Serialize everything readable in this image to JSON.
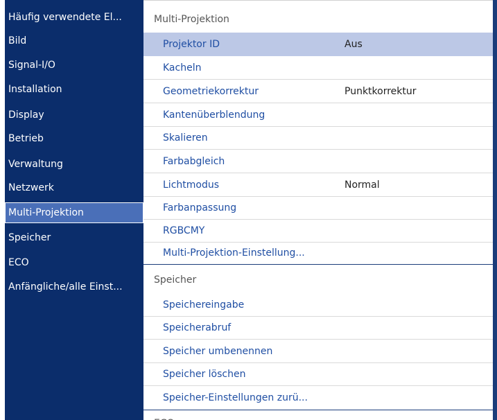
{
  "sidebar": {
    "items": [
      {
        "label": "Häufig verwendete El..."
      },
      {
        "label": "Bild"
      },
      {
        "label": "Signal-I/O"
      },
      {
        "label": "Installation"
      },
      {
        "label": "Display"
      },
      {
        "label": "Betrieb"
      },
      {
        "label": "Verwaltung"
      },
      {
        "label": "Netzwerk"
      },
      {
        "label": "Multi-Projektion"
      },
      {
        "label": "Speicher"
      },
      {
        "label": "ECO"
      },
      {
        "label": "Anfängliche/alle Einst..."
      }
    ],
    "selected_index": 8
  },
  "main": {
    "sections": [
      {
        "title": "Multi-Projektion",
        "rows": [
          {
            "label": "Projektor ID",
            "value": "Aus"
          },
          {
            "label": "Kacheln",
            "value": ""
          },
          {
            "label": "Geometriekorrektur",
            "value": "Punktkorrektur"
          },
          {
            "label": "Kantenüberblendung",
            "value": ""
          },
          {
            "label": "Skalieren",
            "value": ""
          },
          {
            "label": "Farbabgleich",
            "value": ""
          },
          {
            "label": "Lichtmodus",
            "value": "Normal"
          },
          {
            "label": "Farbanpassung",
            "value": ""
          },
          {
            "label": "RGBCMY",
            "value": ""
          },
          {
            "label": "Multi-Projektion-Einstellung...",
            "value": ""
          }
        ]
      },
      {
        "title": "Speicher",
        "rows": [
          {
            "label": "Speichereingabe",
            "value": ""
          },
          {
            "label": "Speicherabruf",
            "value": ""
          },
          {
            "label": "Speicher umbenennen",
            "value": ""
          },
          {
            "label": "Speicher löschen",
            "value": ""
          },
          {
            "label": "Speicher-Einstellungen zurü...",
            "value": ""
          }
        ]
      },
      {
        "title": "ECO",
        "rows": []
      }
    ],
    "selected_row": "Projektor ID"
  },
  "colors": {
    "sidebar_bg": "#0b2d6b",
    "sidebar_selected": "#4a6fb8",
    "row_selected": "#bcc8e6",
    "link_text": "#1f4ea3"
  }
}
